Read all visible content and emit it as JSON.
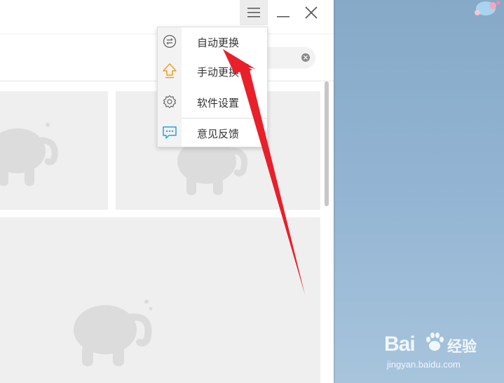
{
  "menu": {
    "items": [
      {
        "label": "自动更换",
        "icon": "switch-icon"
      },
      {
        "label": "手动更换",
        "icon": "upload-arrow-icon"
      },
      {
        "label": "软件设置",
        "icon": "gear-icon"
      },
      {
        "label": "意见反馈",
        "icon": "feedback-chat-icon"
      }
    ]
  },
  "titlebar": {
    "menu_icon": "hamburger-menu-icon",
    "minimize_icon": "minimize-icon",
    "close_icon": "close-icon"
  },
  "search": {
    "clear_icon": "clear-circle-icon"
  },
  "watermark": {
    "brand": "Bai",
    "brand2": "经验",
    "url": "jingyan.baidu.com"
  },
  "colors": {
    "arrow": "#e8202a",
    "upload_icon": "#f0a020",
    "feedback_icon": "#2aa0e0",
    "desktop": "#8fb2d1"
  }
}
